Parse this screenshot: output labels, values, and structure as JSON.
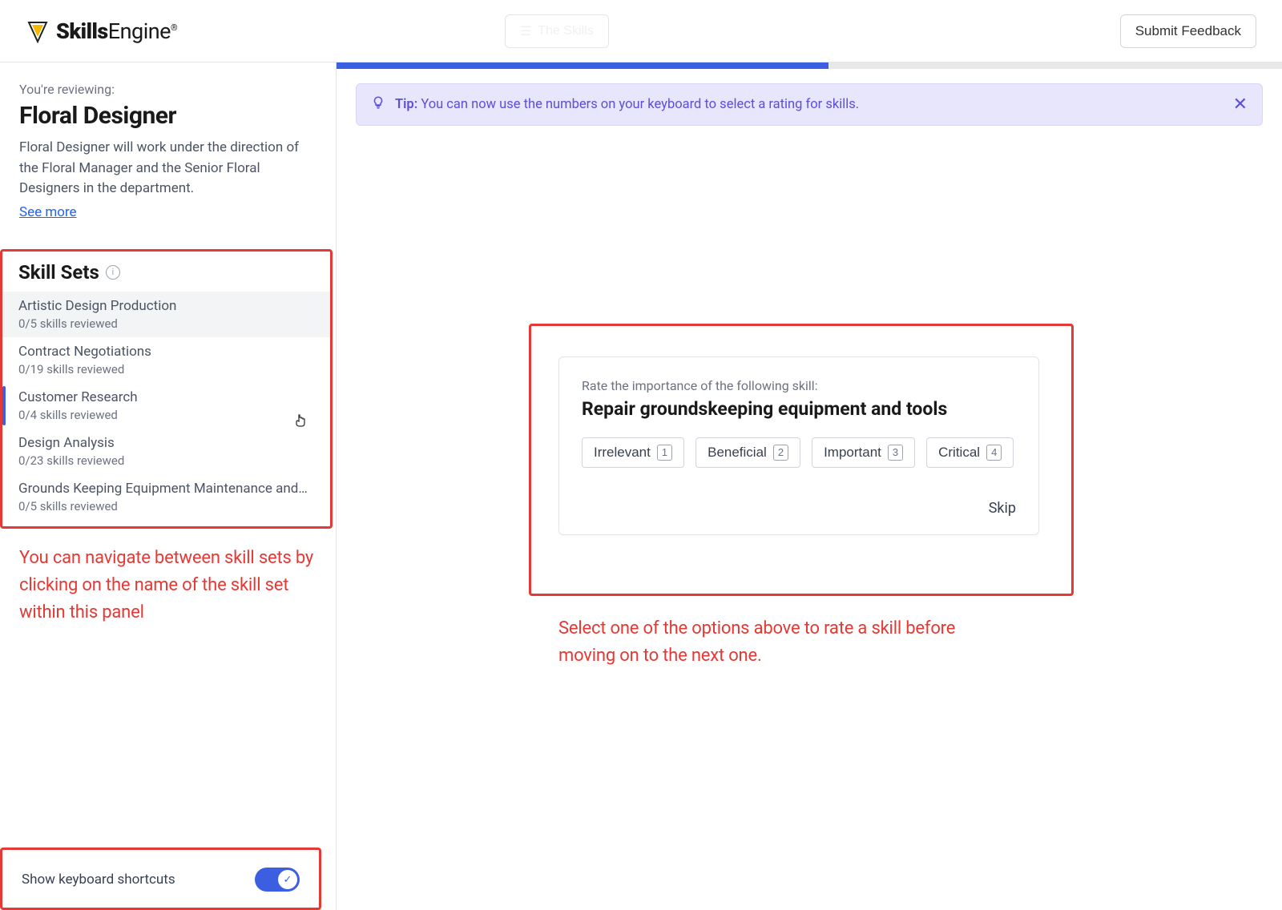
{
  "header": {
    "brand": "SkillsEngine",
    "brand_thin": "",
    "center_button": "The Skills",
    "submit_feedback": "Submit Feedback"
  },
  "sidebar": {
    "reviewing_label": "You're reviewing:",
    "job_title": "Floral Designer",
    "job_description": "Floral Designer will work under the direction of the Floral Manager and the Senior Floral Designers in the department.",
    "see_more": "See more",
    "skill_sets_title": "Skill Sets",
    "items": [
      {
        "name": "Artistic Design Production",
        "progress": "0/5 skills reviewed"
      },
      {
        "name": "Contract Negotiations",
        "progress": "0/19 skills reviewed"
      },
      {
        "name": "Customer Research",
        "progress": "0/4 skills reviewed"
      },
      {
        "name": "Design Analysis",
        "progress": "0/23 skills reviewed"
      },
      {
        "name": "Grounds Keeping Equipment Maintenance and…",
        "progress": "0/5 skills reviewed"
      }
    ],
    "shortcuts_label": "Show keyboard shortcuts"
  },
  "tip": {
    "label": "Tip:",
    "text": "You can now use the numbers on your keyboard to select a rating for skills."
  },
  "rating": {
    "prompt": "Rate the importance of the following skill:",
    "skill": "Repair groundskeeping equipment and tools",
    "options": [
      {
        "label": "Irrelevant",
        "key": "1"
      },
      {
        "label": "Beneficial",
        "key": "2"
      },
      {
        "label": "Important",
        "key": "3"
      },
      {
        "label": "Critical",
        "key": "4"
      }
    ],
    "skip": "Skip"
  },
  "annotations": {
    "sidebar_note": "You can navigate between skill sets by clicking on the name of the skill set within this panel",
    "main_note": "Select one of the options above to rate a skill before moving on to the next one."
  }
}
